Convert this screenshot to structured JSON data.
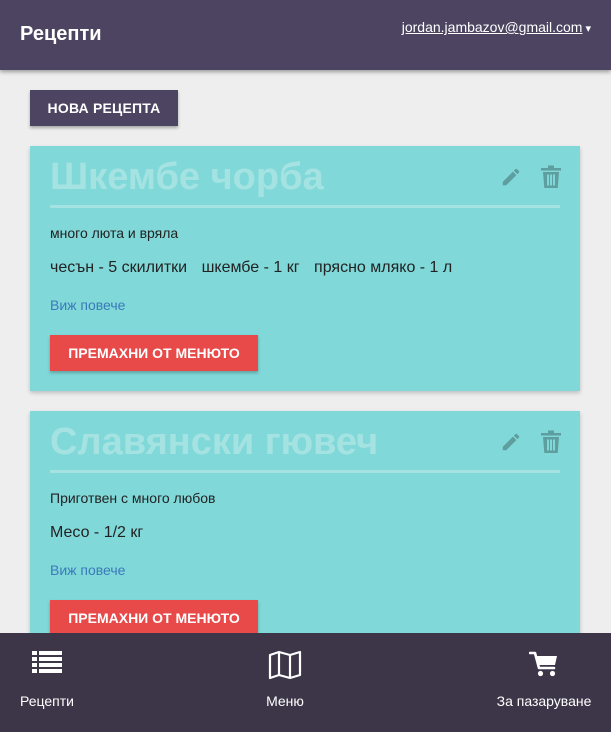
{
  "header": {
    "title": "Рецепти",
    "user_email": "jordan.jambazov@gmail.com",
    "caret": "▾"
  },
  "actions": {
    "new_recipe_label": "НОВА РЕЦЕПТА"
  },
  "recipes": [
    {
      "title": "Шкембе чорба",
      "description": "много люта и вряла",
      "ingredients": [
        "чесън - 5 скилитки",
        "шкембе - 1 кг",
        "прясно мляко - 1 л"
      ],
      "see_more": "Виж повече",
      "remove_label": "ПРЕМАХНИ ОТ МЕНЮТО"
    },
    {
      "title": "Славянски гювеч",
      "description": "Приготвен с много любов",
      "ingredients": [
        "Месо - 1/2 кг"
      ],
      "see_more": "Виж повече",
      "remove_label": "ПРЕМАХНИ ОТ МЕНЮТО"
    }
  ],
  "bottom_nav": {
    "recipes_label": "Рецепти",
    "menu_label": "Меню",
    "shopping_label": "За пазаруване",
    "recipes_icon": "list-icon",
    "menu_icon": "map-icon",
    "shopping_icon": "cart-icon"
  },
  "colors": {
    "header_bg": "#4d4461",
    "nav_bg": "#3d3548",
    "card_bg": "#80d8d9",
    "danger": "#e84a4a",
    "link": "#3a7ab8"
  }
}
